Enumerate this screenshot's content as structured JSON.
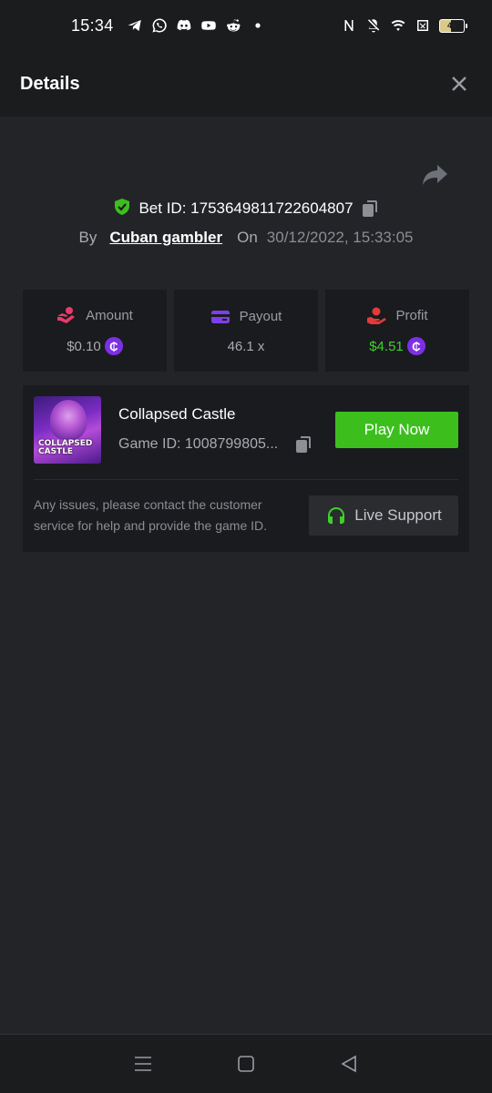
{
  "status_bar": {
    "time": "15:34",
    "battery_level": "46",
    "icons_left": [
      "telegram-icon",
      "whatsapp-icon",
      "discord-icon",
      "youtube-icon",
      "reddit-icon",
      "dot-icon"
    ],
    "icons_right": [
      "nfc-icon",
      "mute-icon",
      "wifi-icon",
      "sim-icon",
      "battery-icon"
    ]
  },
  "header": {
    "title": "Details"
  },
  "bet": {
    "id_label": "Bet ID: 1753649811722604807",
    "by_label": "By",
    "username": "Cuban gambler",
    "on_label": "On",
    "datetime": "30/12/2022, 15:33:05"
  },
  "stats": {
    "amount": {
      "label": "Amount",
      "value": "$0.10"
    },
    "payout": {
      "label": "Payout",
      "value": "46.1 x"
    },
    "profit": {
      "label": "Profit",
      "value": "$4.51"
    }
  },
  "game": {
    "name": "Collapsed Castle",
    "id_label": "Game ID: 1008799805...",
    "thumb_text_1": "COLLAPSED",
    "thumb_text_2": "CASTLE",
    "play_label": "Play Now",
    "issue_text": "Any issues, please contact the customer service for help and provide the game ID.",
    "support_label": "Live Support"
  },
  "colors": {
    "background": "#232427",
    "card": "#1a1b1e",
    "accent_green": "#3cbf1d",
    "profit_green": "#3ed12b",
    "coin_purple": "#7d2fe6",
    "amount_icon": "#e83a6a",
    "payout_icon": "#7d3fe8",
    "profit_icon": "#e33b3b"
  }
}
